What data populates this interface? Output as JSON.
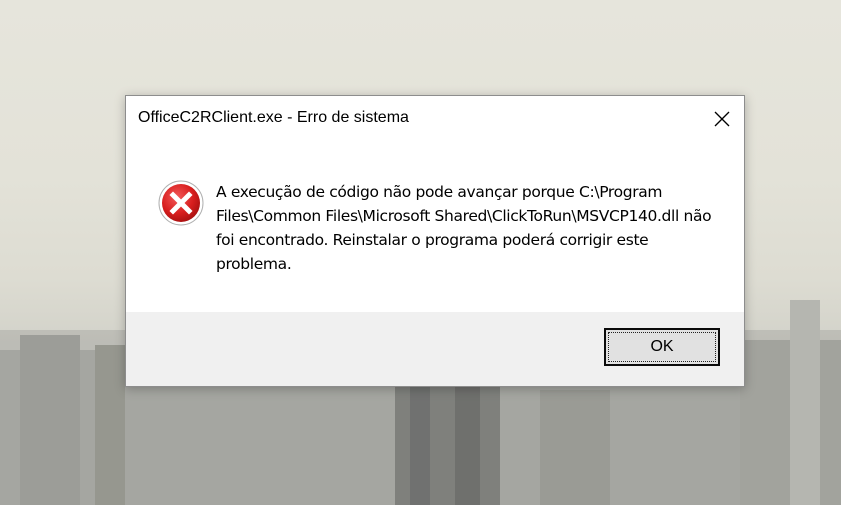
{
  "dialog": {
    "title": "OfficeC2RClient.exe - Erro de sistema",
    "message": "A execução de código não pode avançar porque C:\\Program Files\\Common Files\\Microsoft Shared\\ClickToRun\\MSVCP140.dll não foi encontrado. Reinstalar o programa poderá corrigir este problema.",
    "ok_label": "OK",
    "icon": "error-icon",
    "close_icon": "close-icon"
  },
  "colors": {
    "error_red": "#d81e1e",
    "footer_bg": "#f0f0f0",
    "button_bg": "#e1e1e1"
  }
}
